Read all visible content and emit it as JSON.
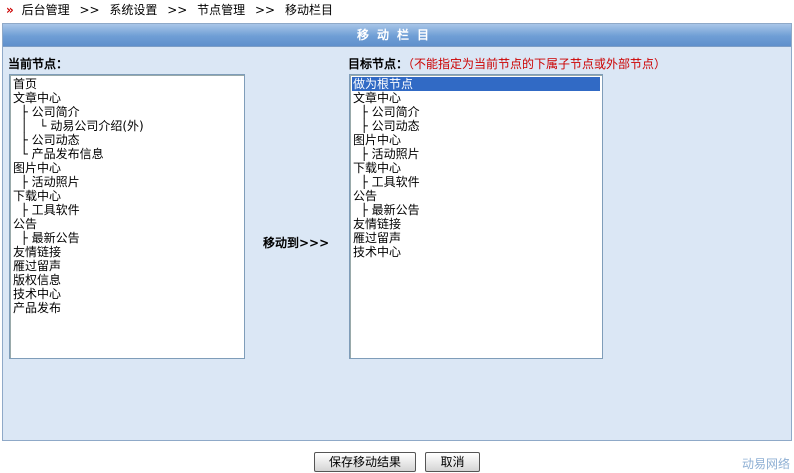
{
  "breadcrumb": {
    "arrow": "»",
    "items": [
      "后台管理",
      "系统设置",
      "节点管理",
      "移动栏目"
    ],
    "separator": ">>"
  },
  "panel": {
    "title": "移动栏目"
  },
  "current": {
    "label": "当前节点：",
    "options": [
      "首页",
      "文章中心",
      "  ├ 公司简介",
      "  │   └ 动易公司介绍(外)",
      "  ├ 公司动态",
      "  └ 产品发布信息",
      "图片中心",
      "  ├ 活动照片",
      "下载中心",
      "  ├ 工具软件",
      "公告",
      "  ├ 最新公告",
      "友情链接",
      "雁过留声",
      "版权信息",
      "技术中心",
      "产品发布"
    ]
  },
  "target": {
    "label": "目标节点：",
    "warning": "（不能指定为当前节点的下属子节点或外部节点）",
    "options": [
      "做为根节点",
      "文章中心",
      "  ├ 公司简介",
      "  ├ 公司动态",
      "图片中心",
      "  ├ 活动照片",
      "下载中心",
      "  ├ 工具软件",
      "公告",
      "  ├ 最新公告",
      "友情链接",
      "雁过留声",
      "技术中心"
    ],
    "selected_index": 0
  },
  "move_label": "移动到>>>",
  "buttons": {
    "save": "保存移动结果",
    "cancel": "取消"
  },
  "footer": "动易网络"
}
